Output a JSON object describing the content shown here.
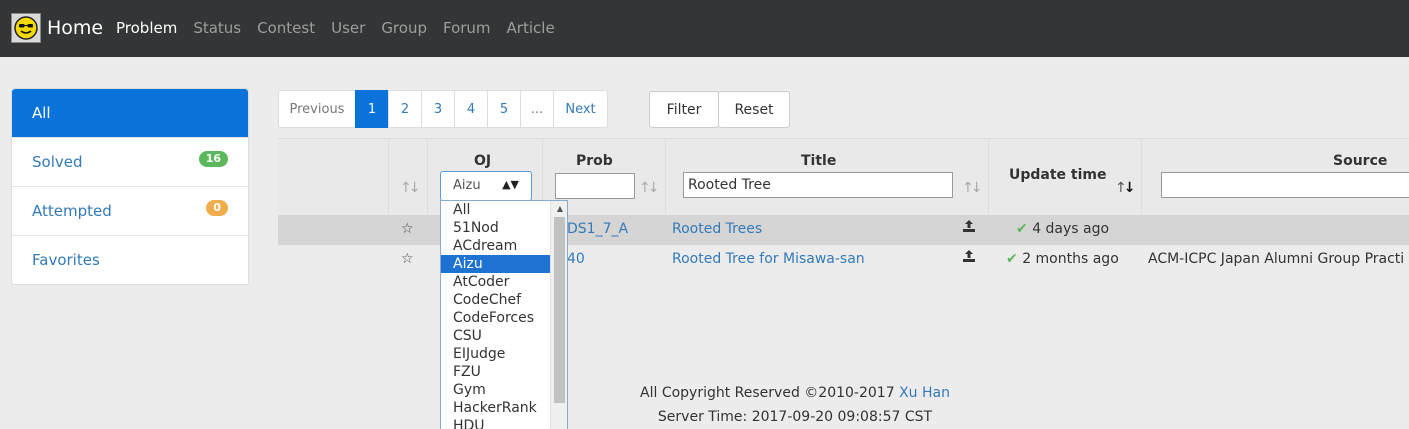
{
  "navbar": {
    "brand": "Home",
    "items": [
      "Problem",
      "Status",
      "Contest",
      "User",
      "Group",
      "Forum",
      "Article"
    ]
  },
  "sidebar": {
    "items": [
      {
        "label": "All",
        "badge": ""
      },
      {
        "label": "Solved",
        "badge": "16"
      },
      {
        "label": "Attempted",
        "badge": "0"
      },
      {
        "label": "Favorites",
        "badge": ""
      }
    ]
  },
  "pagination": {
    "prev": "Previous",
    "pages": [
      "1",
      "2",
      "3",
      "4",
      "5",
      "..."
    ],
    "next": "Next",
    "current": "1"
  },
  "buttons": {
    "filter": "Filter",
    "reset": "Reset"
  },
  "table": {
    "headers": {
      "oj": "OJ",
      "prob": "Prob",
      "title": "Title",
      "update_time": "Update time",
      "source": "Source"
    },
    "filters": {
      "oj_selected": "Aizu",
      "prob": "",
      "title": "Rooted Tree",
      "source": ""
    },
    "rows": [
      {
        "prob": "DS1_7_A",
        "title": "Rooted Trees",
        "update": "4 days ago",
        "source": ""
      },
      {
        "prob": "40",
        "title": "Rooted Tree for Misawa-san",
        "update": "2 months ago",
        "source": "ACM-ICPC Japan Alumni Group Practi"
      }
    ]
  },
  "oj_options": [
    "All",
    "51Nod",
    "ACdream",
    "Aizu",
    "AtCoder",
    "CodeChef",
    "CodeForces",
    "CSU",
    "EIJudge",
    "FZU",
    "Gym",
    "HackerRank",
    "HDU"
  ],
  "footer": {
    "copyright": "All Copyright Reserved ©2010-2017",
    "author": "Xu Han",
    "server_time": "Server Time: 2017-09-20 09:08:57 CST"
  },
  "colors": {
    "navbar": "#333536",
    "accent": "#0a73d9",
    "link": "#337ab7",
    "success": "#5cb85c",
    "warning": "#f0ad4e"
  }
}
